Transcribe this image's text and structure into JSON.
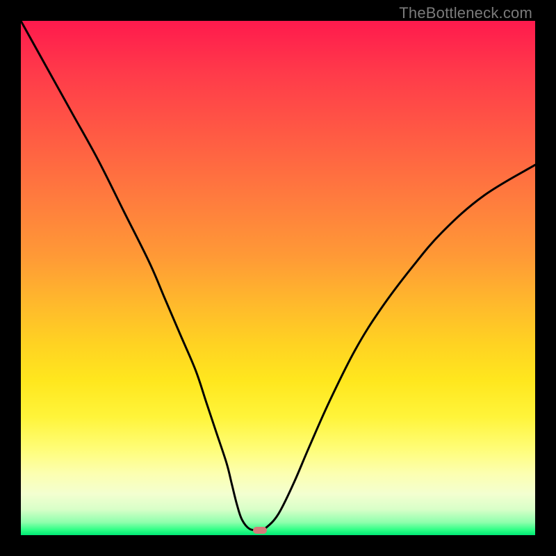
{
  "watermark": "TheBottleneck.com",
  "chart_data": {
    "type": "line",
    "title": "",
    "xlabel": "",
    "ylabel": "",
    "xlim": [
      0,
      100
    ],
    "ylim": [
      0,
      100
    ],
    "grid": false,
    "series": [
      {
        "name": "bottleneck-curve",
        "x": [
          0,
          5,
          10,
          15,
          20,
          25,
          28,
          31,
          34,
          36,
          38,
          40,
          41,
          42,
          43,
          44.5,
          46.5,
          47.5,
          50,
          53,
          56,
          60,
          65,
          70,
          76,
          82,
          90,
          100
        ],
        "values": [
          100,
          91,
          82,
          73,
          63,
          53,
          46,
          39,
          32,
          26,
          20,
          14,
          10,
          6,
          3,
          1.2,
          1,
          1.3,
          4,
          10,
          17,
          26,
          36,
          44,
          52,
          59,
          66,
          72
        ]
      }
    ],
    "marker": {
      "x": 46.5,
      "y": 1
    },
    "gradient_stops": [
      {
        "pct": 0,
        "color": "#ff1a4d"
      },
      {
        "pct": 50,
        "color": "#ffb02c"
      },
      {
        "pct": 80,
        "color": "#fffb60"
      },
      {
        "pct": 100,
        "color": "#00e874"
      }
    ]
  }
}
